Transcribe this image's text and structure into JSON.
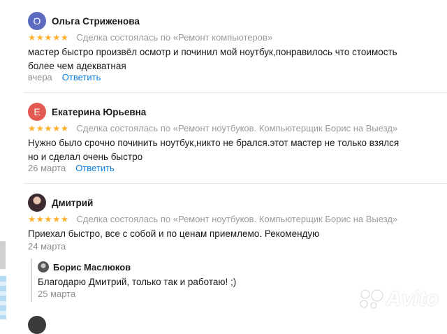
{
  "reviews": [
    {
      "avatar_letter": "О",
      "avatar_color": "#5c6bc0",
      "author": "Ольга Стриженова",
      "stars": "★★★★★",
      "deal": "Сделка состоялась по «Ремонт компьютеров»",
      "text": "мастер быстро произвёл осмотр и починил мой ноутбук,понравилось что стоимость более чем адекватная",
      "date": "вчера",
      "reply_label": "Ответить"
    },
    {
      "avatar_letter": "Е",
      "avatar_color": "#e35a52",
      "author": "Екатерина Юрьевна",
      "stars": "★★★★★",
      "deal": "Сделка состоялась по «Ремонт ноутбуков. Компьютерщик Борис на Выезд»",
      "text": "Нужно было срочно починить ноутбук,никто не брался.этот мастер не только взялся но и сделал очень быстро",
      "date": "26 марта",
      "reply_label": "Ответить"
    },
    {
      "avatar_letter": "",
      "avatar_color": "#3b2a2e",
      "author": "Дмитрий",
      "stars": "★★★★★",
      "deal": "Сделка состоялась по «Ремонт ноутбуков. Компьютерщик Борис на Выезд»",
      "text": "Приехал быстро, все с собой и по ценам приемлемо. Рекомендую",
      "date": "24 марта"
    }
  ],
  "seller_answer": {
    "author": "Борис Маслюков",
    "text": "Благодарю Дмитрий, только так и работаю! ;)",
    "date": "25 марта"
  },
  "watermark": "Avito"
}
